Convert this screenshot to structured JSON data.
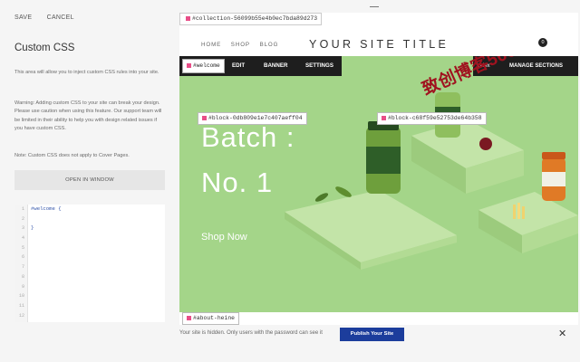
{
  "left_panel": {
    "save_label": "SAVE",
    "cancel_label": "CANCEL",
    "title": "Custom CSS",
    "intro_text": "This area will allow you to inject custom CSS rules into your site.",
    "warning_text": "Warning: Adding custom CSS to your site can break your design. Please use caution when using this feature. Our support team will be limited in their ability to help you with design related issues if you have custom CSS.",
    "note_text": "Note: Custom CSS does not apply to Cover Pages.",
    "open_window_label": "OPEN IN WINDOW",
    "editor": {
      "line_numbers": [
        "1",
        "2",
        "3",
        "4",
        "5",
        "6",
        "7",
        "8",
        "9",
        "10",
        "11",
        "12"
      ],
      "lines": [
        "#welcome {",
        "",
        "}",
        "",
        "",
        "",
        "",
        "",
        "",
        "",
        "",
        ""
      ]
    }
  },
  "preview": {
    "collection_selector": "#collection-56099b55e4b0ec7bda89d273",
    "nav": [
      "HOME",
      "SHOP",
      "BLOG"
    ],
    "site_title": "YOUR SITE TITLE",
    "cart_count": "0",
    "welcome_selector": "#welcome",
    "edit_label": "EDIT",
    "banner_label": "BANNER",
    "settings_label": "SETTINGS",
    "index_label": "Index",
    "manage_sections_label": "MANAGE SECTIONS",
    "block_selector_1": "#block-0db809e1e7c407aeff04",
    "block_selector_2": "#block-c68f59e52753de64b358",
    "hero_line_1": "Batch :",
    "hero_line_2": "No. 1",
    "shop_now": "Shop Now",
    "watermark": "致创博客566",
    "about_selector": "#about-heine"
  },
  "bottom_bar": {
    "message": "Your site is hidden. Only users with the password can see it",
    "publish_label": "Publish Your Site",
    "close_symbol": "✕"
  },
  "colors": {
    "hero_bg": "#a4d589",
    "edit_bar": "#1e1e1e",
    "publish_btn": "#1c3d9c",
    "selector_dot": "#e84e88",
    "watermark": "#a0121f"
  }
}
